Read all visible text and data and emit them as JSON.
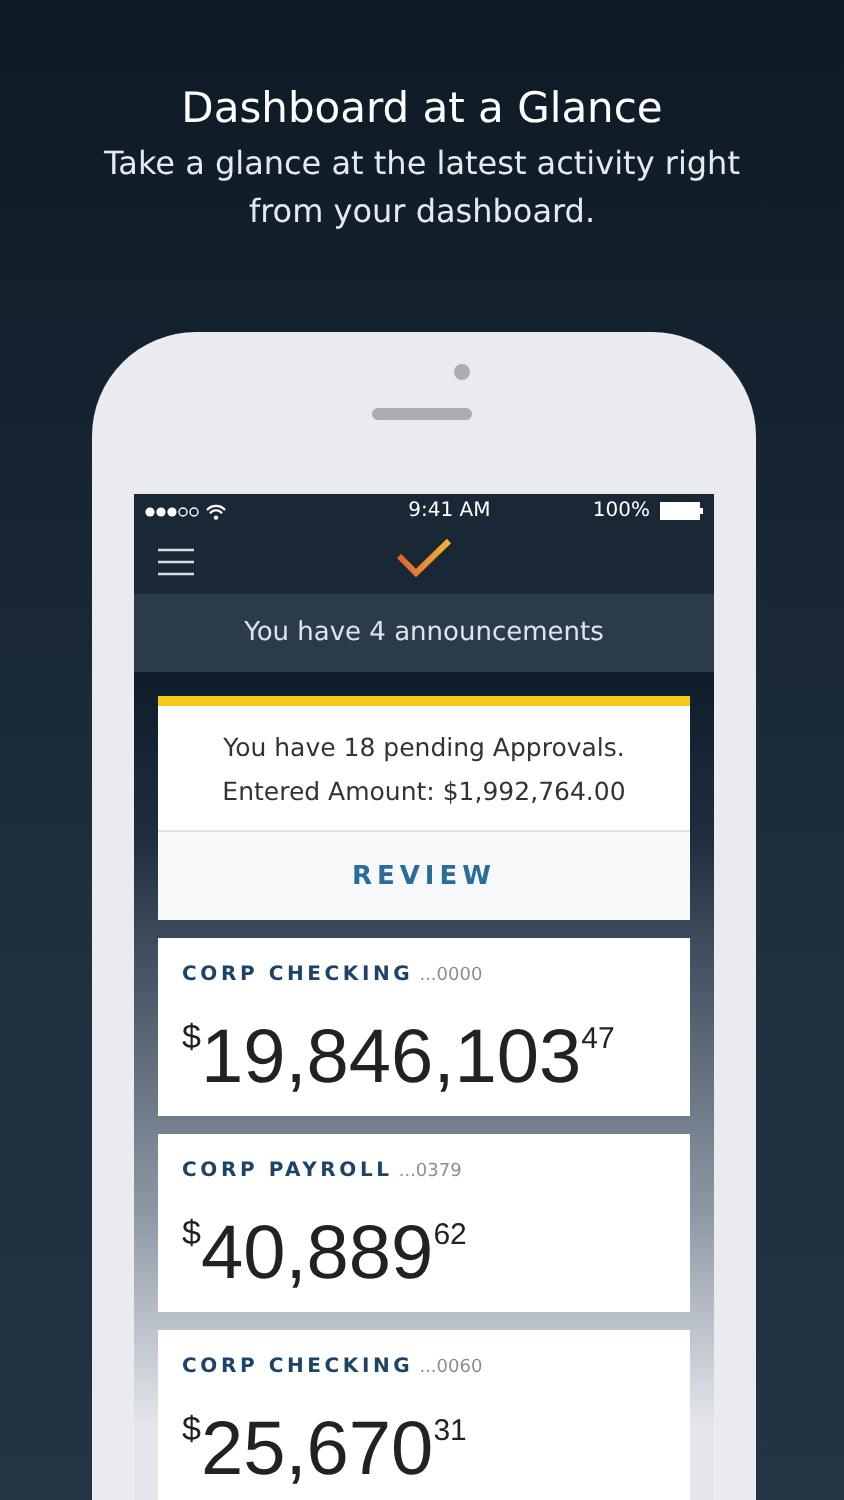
{
  "headline": "Dashboard at a Glance",
  "subtitle": "Take a glance at the latest activity right from your dashboard.",
  "status_bar": {
    "time": "9:41 AM",
    "battery": "100%"
  },
  "announcements": "You have 4 announcements",
  "approvals": {
    "message": "You have 18 pending Approvals.",
    "amount": "Entered Amount: $1,992,764.00",
    "action": "REVIEW"
  },
  "accounts": [
    {
      "name": "CORP CHECKING",
      "number": "...0000",
      "currency": "$",
      "whole": "19,846,103",
      "cents": "47"
    },
    {
      "name": "CORP PAYROLL",
      "number": "...0379",
      "currency": "$",
      "whole": "40,889",
      "cents": "62"
    },
    {
      "name": "CORP CHECKING",
      "number": "...0060",
      "currency": "$",
      "whole": "25,670",
      "cents": "31"
    }
  ]
}
